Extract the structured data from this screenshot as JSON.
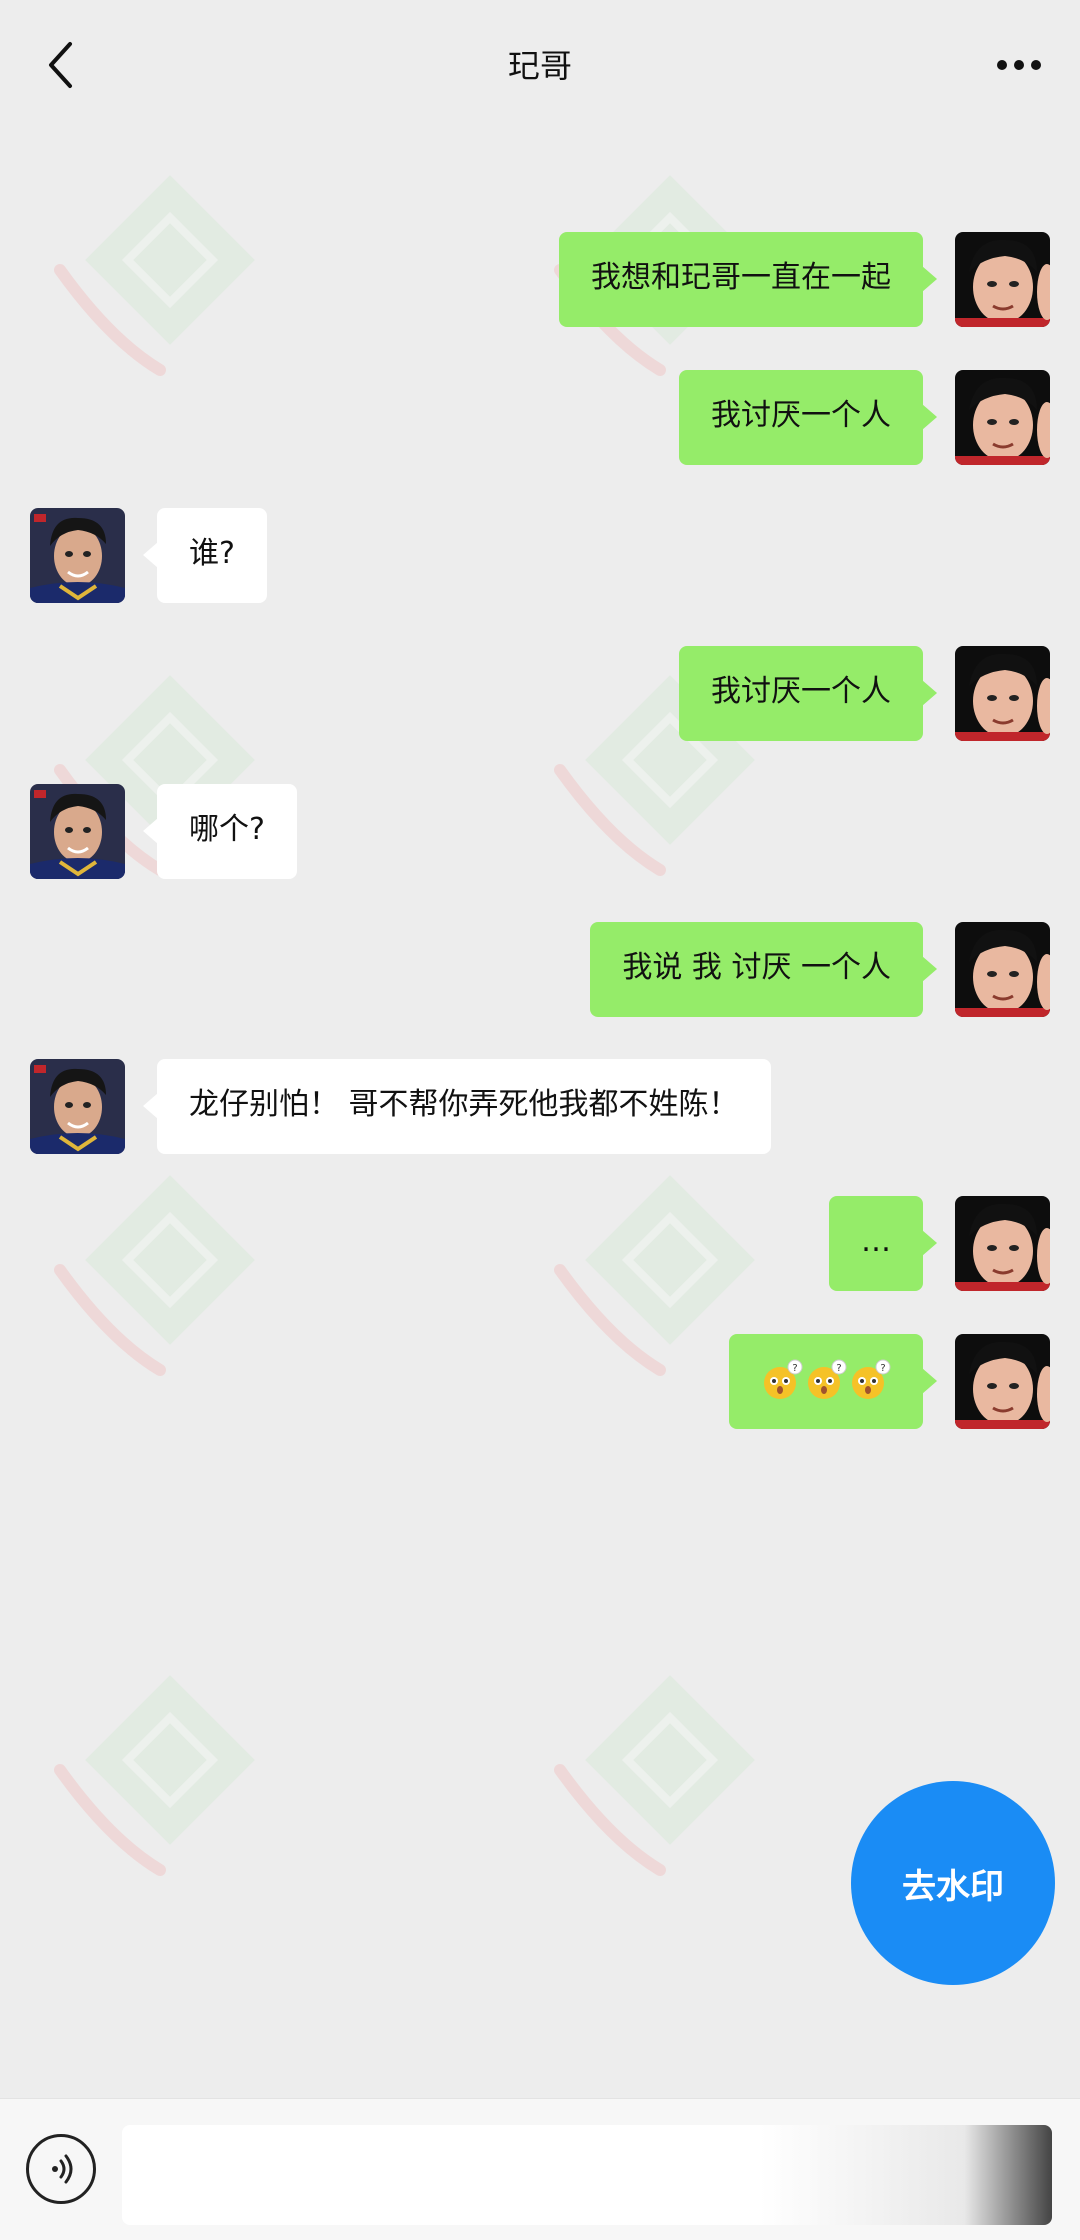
{
  "header": {
    "title": "玘哥",
    "back_icon": "chevron-left-icon",
    "more_icon": "more-dots-icon"
  },
  "messages": [
    {
      "side": "right",
      "text": "我想和玘哥一直在一起",
      "avatar": "avatar-me"
    },
    {
      "side": "right",
      "text": "我讨厌一个人",
      "avatar": "avatar-me"
    },
    {
      "side": "left",
      "text": "谁?",
      "avatar": "avatar-contact"
    },
    {
      "side": "right",
      "text": "我讨厌一个人",
      "avatar": "avatar-me"
    },
    {
      "side": "left",
      "text": "哪个?",
      "avatar": "avatar-contact"
    },
    {
      "side": "right",
      "text": "我说 我 讨厌 一个人",
      "avatar": "avatar-me"
    },
    {
      "side": "left",
      "text": "龙仔别怕！ 哥不帮你弄死他我都不姓陈！",
      "avatar": "avatar-contact"
    },
    {
      "side": "right",
      "text": "…",
      "avatar": "avatar-me"
    },
    {
      "side": "right",
      "text": "",
      "emoji": "confused-face-emoji x3",
      "avatar": "avatar-me"
    }
  ],
  "fab": {
    "label": "去水印"
  },
  "input": {
    "value": "",
    "placeholder": ""
  },
  "colors": {
    "background": "#ededed",
    "bubble_mine": "#95ec69",
    "bubble_theirs": "#ffffff",
    "fab": "#1a8cf5"
  }
}
